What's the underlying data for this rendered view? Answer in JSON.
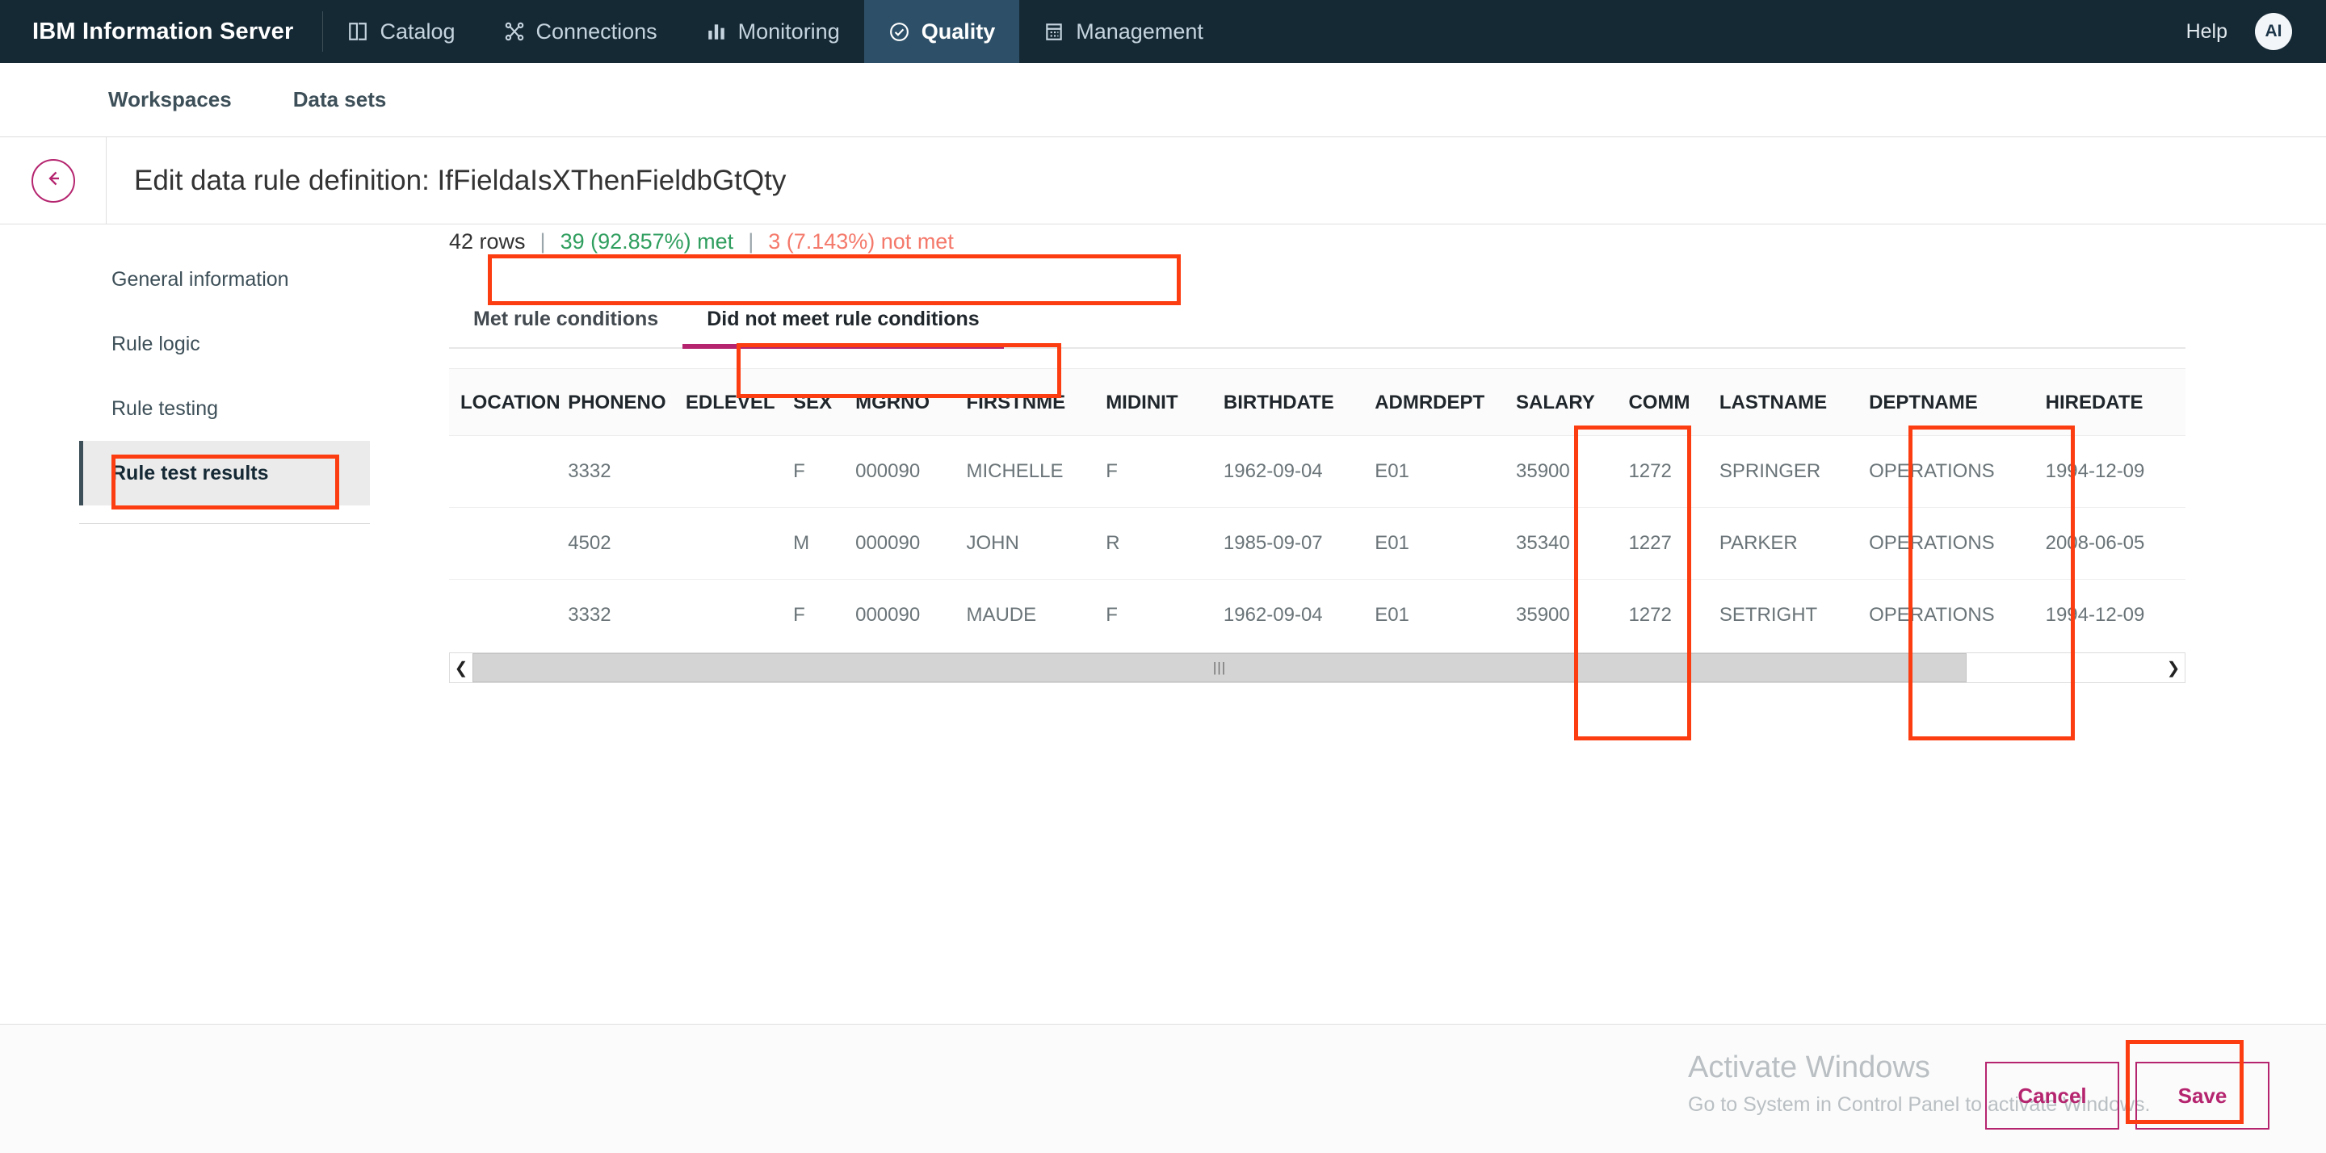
{
  "topnav": {
    "brand": "IBM Information Server",
    "items": [
      {
        "label": "Catalog",
        "icon": "book-icon",
        "active": false
      },
      {
        "label": "Connections",
        "icon": "connections-icon",
        "active": false
      },
      {
        "label": "Monitoring",
        "icon": "bar-chart-icon",
        "active": false
      },
      {
        "label": "Quality",
        "icon": "check-circle-icon",
        "active": true
      },
      {
        "label": "Management",
        "icon": "clipboard-icon",
        "active": false
      }
    ],
    "help": "Help",
    "avatar": "AI"
  },
  "subnav": {
    "items": [
      {
        "label": "Workspaces"
      },
      {
        "label": "Data sets"
      }
    ]
  },
  "title": {
    "back_icon": "back-arrow-icon",
    "text": "Edit data rule definition: IfFieldaIsXThenFieldbGtQty"
  },
  "sidebar": {
    "items": [
      {
        "label": "General information",
        "active": false
      },
      {
        "label": "Rule logic",
        "active": false
      },
      {
        "label": "Rule testing",
        "active": false
      },
      {
        "label": "Rule test results",
        "active": true
      }
    ]
  },
  "stats": {
    "rows": "42 rows",
    "sep": "|",
    "met": "39 (92.857%) met",
    "not_met": "3 (7.143%) not met"
  },
  "tabs": [
    {
      "label": "Met rule conditions",
      "active": false
    },
    {
      "label": "Did not meet rule conditions",
      "active": true
    }
  ],
  "table": {
    "columns": [
      "LOCATION",
      "PHONENO",
      "EDLEVEL",
      "SEX",
      "MGRNO",
      "FIRSTNME",
      "MIDINIT",
      "BIRTHDATE",
      "ADMRDEPT",
      "SALARY",
      "COMM",
      "LASTNAME",
      "DEPTNAME",
      "HIREDATE"
    ],
    "rows": [
      {
        "LOCATION": "",
        "PHONENO": "3332",
        "EDLEVEL": "",
        "SEX": "F",
        "MGRNO": "000090",
        "FIRSTNME": "MICHELLE",
        "MIDINIT": "F",
        "BIRTHDATE": "1962-09-04",
        "ADMRDEPT": "E01",
        "SALARY": "35900",
        "COMM": "1272",
        "LASTNAME": "SPRINGER",
        "DEPTNAME": "OPERATIONS",
        "HIREDATE": "1994-12-09"
      },
      {
        "LOCATION": "",
        "PHONENO": "4502",
        "EDLEVEL": "",
        "SEX": "M",
        "MGRNO": "000090",
        "FIRSTNME": "JOHN",
        "MIDINIT": "R",
        "BIRTHDATE": "1985-09-07",
        "ADMRDEPT": "E01",
        "SALARY": "35340",
        "COMM": "1227",
        "LASTNAME": "PARKER",
        "DEPTNAME": "OPERATIONS",
        "HIREDATE": "2008-06-05"
      },
      {
        "LOCATION": "",
        "PHONENO": "3332",
        "EDLEVEL": "",
        "SEX": "F",
        "MGRNO": "000090",
        "FIRSTNME": "MAUDE",
        "MIDINIT": "F",
        "BIRTHDATE": "1962-09-04",
        "ADMRDEPT": "E01",
        "SALARY": "35900",
        "COMM": "1272",
        "LASTNAME": "SETRIGHT",
        "DEPTNAME": "OPERATIONS",
        "HIREDATE": "1994-12-09"
      }
    ]
  },
  "scrollbar": {
    "left_icon": "chevron-left-icon",
    "right_icon": "chevron-right-icon",
    "grip": "|||"
  },
  "footer": {
    "cancel": "Cancel",
    "save": "Save",
    "watermark_title": "Activate Windows",
    "watermark_sub": "Go to System in Control Panel to activate Windows."
  },
  "colors": {
    "nav_bg": "#152935",
    "nav_active": "#2d5068",
    "accent_magenta": "#b5256f",
    "met_green": "#2f9e5e",
    "not_met_red": "#f4796b",
    "annotation_red": "#fc3d11"
  }
}
